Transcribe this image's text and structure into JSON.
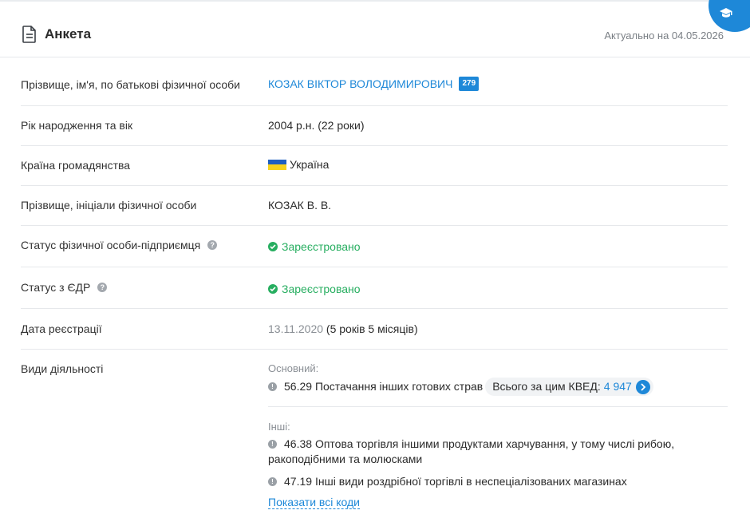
{
  "header": {
    "title": "Анкета",
    "updated": "Актуально на 04.05.2026"
  },
  "rows": {
    "full_name": {
      "label": "Прізвище, ім'я, по батькові фізичної особи",
      "value": "КОЗАК ВІКТОР ВОЛОДИМИРОВИЧ",
      "badge": "279"
    },
    "birth": {
      "label": "Рік народження та вік",
      "value": "2004 р.н. (22 роки)"
    },
    "citizenship": {
      "label": "Країна громадянства",
      "value": "Україна"
    },
    "initials": {
      "label": "Прізвище, ініціали фізичної особи",
      "value": "КОЗАК В. В."
    },
    "fop_status": {
      "label": "Статус фізичної особи-підприємця",
      "value": "Зареєстровано"
    },
    "edr_status": {
      "label": "Статус з ЄДР",
      "value": "Зареєстровано"
    },
    "reg_date": {
      "label": "Дата реєстрації",
      "date": "13.11.2020",
      "duration": "(5 років 5 місяців)"
    },
    "activities": {
      "label": "Види діяльності",
      "main_label": "Основний:",
      "main": {
        "code": "56.29",
        "text": "Постачання інших готових страв"
      },
      "total_label": "Всього за цим КВЕД:",
      "total_value": "4 947",
      "other_label": "Інші:",
      "other": [
        {
          "code": "46.38",
          "text_line1": "Оптова торгівля іншими продуктами харчування, у тому числі рибою,",
          "text_line2": "ракоподібними та молюсками"
        },
        {
          "code": "47.19",
          "text_line1": "Інші види роздрібної торгівлі в неспеціалізованих магазинах"
        }
      ],
      "show_all": "Показати всі коди"
    }
  },
  "colors": {
    "accent": "#1e88d8",
    "success": "#27ae60",
    "muted": "#8a8f95"
  },
  "icons": [
    "document-icon",
    "graduation-cap-icon",
    "help-icon",
    "ukraine-flag-icon",
    "check-icon",
    "info-icon",
    "chevron-right-icon"
  ]
}
